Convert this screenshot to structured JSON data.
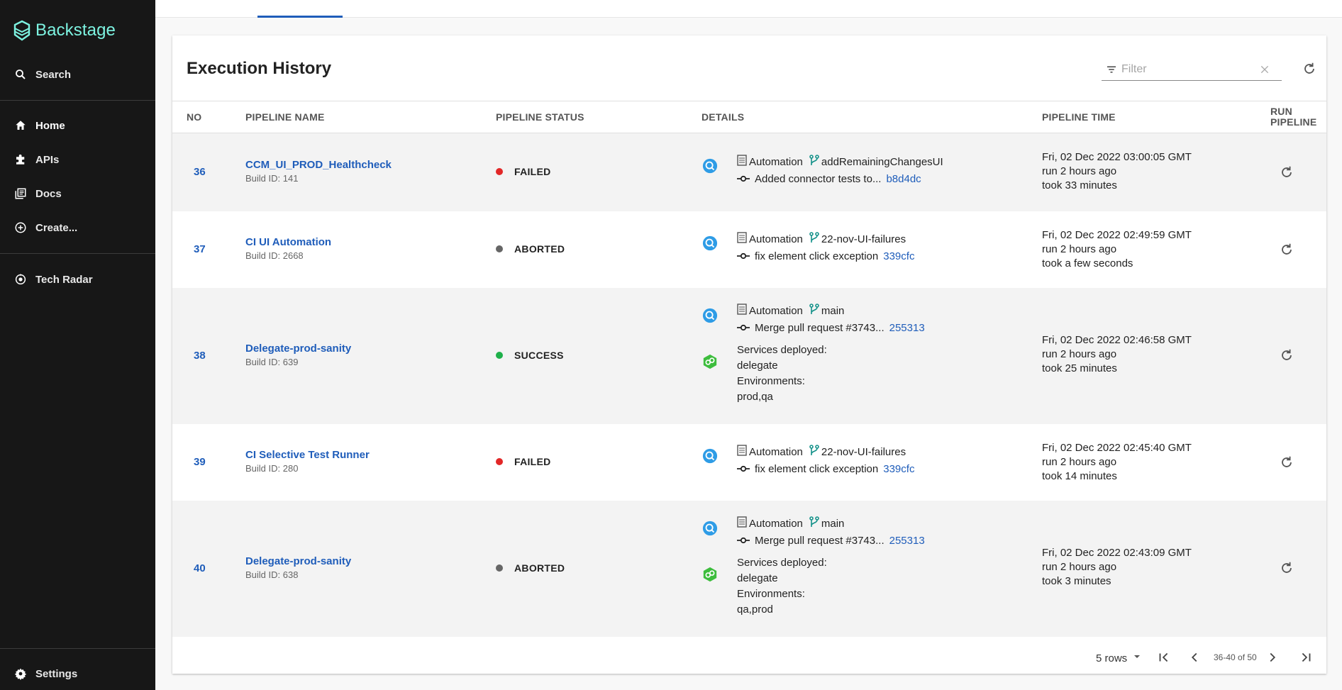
{
  "sidebar": {
    "logo_text": "Backstage",
    "items": [
      {
        "label": "Search",
        "icon": "search-icon"
      },
      {
        "label": "Home",
        "icon": "home-icon"
      },
      {
        "label": "APIs",
        "icon": "puzzle-icon"
      },
      {
        "label": "Docs",
        "icon": "library-icon"
      },
      {
        "label": "Create...",
        "icon": "add-circle-icon"
      },
      {
        "label": "Tech Radar",
        "icon": "radar-icon"
      },
      {
        "label": "Settings",
        "icon": "gear-icon"
      }
    ]
  },
  "card": {
    "title": "Execution History",
    "filter_placeholder": "Filter"
  },
  "table": {
    "headers": {
      "no": "NO",
      "pipeline_name": "PIPELINE NAME",
      "pipeline_status": "PIPELINE STATUS",
      "details": "DETAILS",
      "pipeline_time": "PIPELINE TIME",
      "run_pipeline_1": "RUN",
      "run_pipeline_2": "PIPELINE"
    },
    "rows": [
      {
        "no": "36",
        "name": "CCM_UI_PROD_Healthcheck",
        "build": "Build ID: 141",
        "status": "FAILED",
        "repo": "Automation",
        "branch": "addRemainingChangesUI",
        "commit_msg": "Added connector tests to...",
        "commit_id": "b8d4dc",
        "time": "Fri, 02 Dec 2022 03:00:05 GMT",
        "run_ago": "run 2 hours ago",
        "took": "took 33 minutes"
      },
      {
        "no": "37",
        "name": "CI UI Automation",
        "build": "Build ID: 2668",
        "status": "ABORTED",
        "repo": "Automation",
        "branch": "22-nov-UI-failures",
        "commit_msg": "fix element click exception",
        "commit_id": "339cfc",
        "time": "Fri, 02 Dec 2022 02:49:59 GMT",
        "run_ago": "run 2 hours ago",
        "took": "took a few seconds"
      },
      {
        "no": "38",
        "name": "Delegate-prod-sanity",
        "build": "Build ID: 639",
        "status": "SUCCESS",
        "repo": "Automation",
        "branch": "main",
        "commit_msg": "Merge pull request #3743...",
        "commit_id": "255313",
        "services_label": "Services deployed:",
        "services": "delegate",
        "env_label": "Environments:",
        "envs": "prod,qa",
        "time": "Fri, 02 Dec 2022 02:46:58 GMT",
        "run_ago": "run 2 hours ago",
        "took": "took 25 minutes"
      },
      {
        "no": "39",
        "name": "CI Selective Test Runner",
        "build": "Build ID: 280",
        "status": "FAILED",
        "repo": "Automation",
        "branch": "22-nov-UI-failures",
        "commit_msg": "fix element click exception",
        "commit_id": "339cfc",
        "time": "Fri, 02 Dec 2022 02:45:40 GMT",
        "run_ago": "run 2 hours ago",
        "took": "took 14 minutes"
      },
      {
        "no": "40",
        "name": "Delegate-prod-sanity",
        "build": "Build ID: 638",
        "status": "ABORTED",
        "repo": "Automation",
        "branch": "main",
        "commit_msg": "Merge pull request #3743...",
        "commit_id": "255313",
        "services_label": "Services deployed:",
        "services": "delegate",
        "env_label": "Environments:",
        "envs": "qa,prod",
        "time": "Fri, 02 Dec 2022 02:43:09 GMT",
        "run_ago": "run 2 hours ago",
        "took": "took 3 minutes"
      }
    ]
  },
  "pagination": {
    "rows_per_page": "5 rows",
    "range": "36-40 of 50"
  },
  "colors": {
    "sidebar_bg": "#171717",
    "link": "#1f5dba",
    "failed": "#e22727",
    "aborted": "#666666",
    "success": "#1eb04a",
    "logo": "#7df3e1"
  }
}
